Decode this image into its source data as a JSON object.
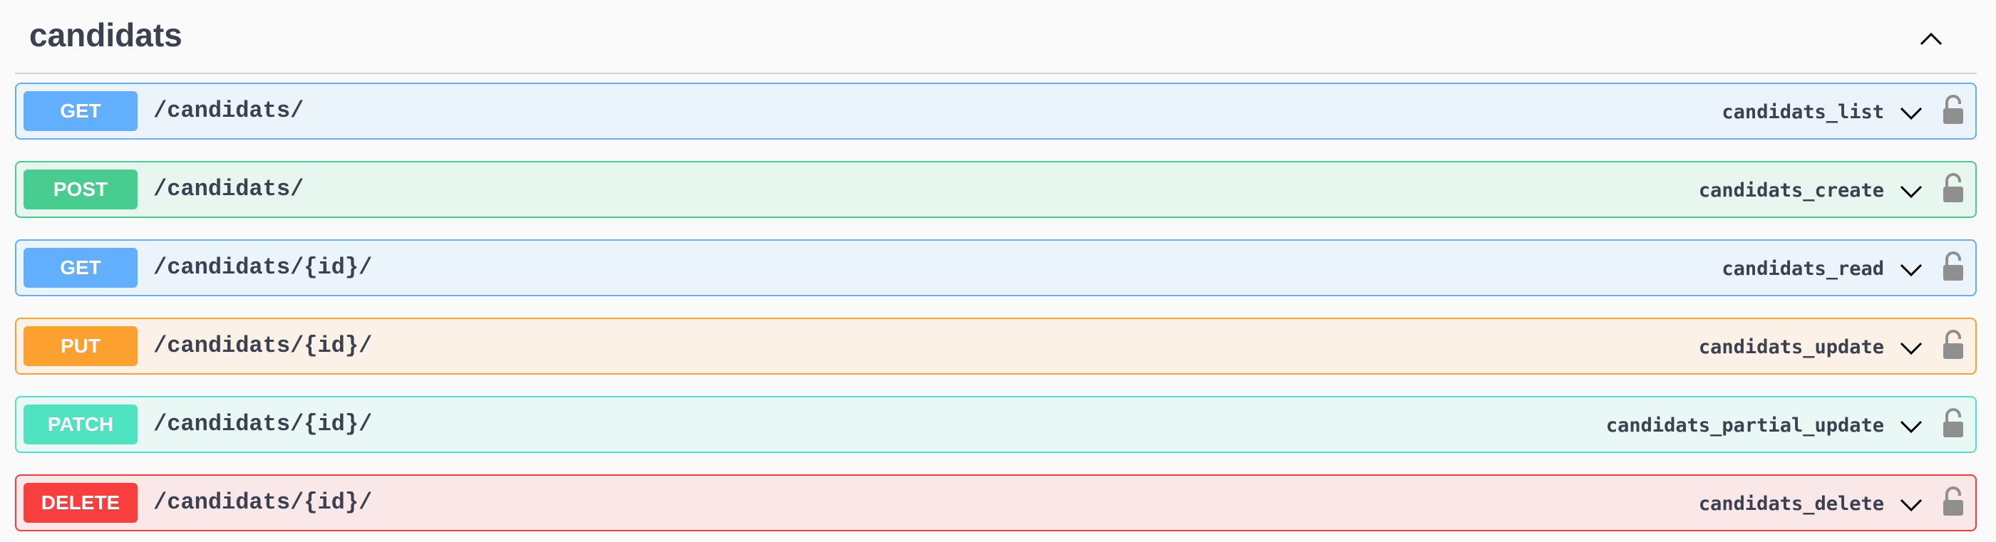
{
  "tag": {
    "title": "candidats"
  },
  "colors": {
    "get": "#61affe",
    "post": "#49cc90",
    "put": "#fca130",
    "patch": "#50e3c2",
    "delete": "#f93e3e",
    "text": "#3b4151"
  },
  "operations": [
    {
      "method": "GET",
      "path": "/candidats/",
      "operation_id": "candidats_list",
      "expand_icon": "chevron-down-icon",
      "auth_icon": "lock-icon"
    },
    {
      "method": "POST",
      "path": "/candidats/",
      "operation_id": "candidats_create",
      "expand_icon": "chevron-down-icon",
      "auth_icon": "lock-icon"
    },
    {
      "method": "GET",
      "path": "/candidats/{id}/",
      "operation_id": "candidats_read",
      "expand_icon": "chevron-down-icon",
      "auth_icon": "lock-icon"
    },
    {
      "method": "PUT",
      "path": "/candidats/{id}/",
      "operation_id": "candidats_update",
      "expand_icon": "chevron-down-icon",
      "auth_icon": "lock-icon"
    },
    {
      "method": "PATCH",
      "path": "/candidats/{id}/",
      "operation_id": "candidats_partial_update",
      "expand_icon": "chevron-down-icon",
      "auth_icon": "lock-icon"
    },
    {
      "method": "DELETE",
      "path": "/candidats/{id}/",
      "operation_id": "candidats_delete",
      "expand_icon": "chevron-down-icon",
      "auth_icon": "lock-icon"
    }
  ]
}
